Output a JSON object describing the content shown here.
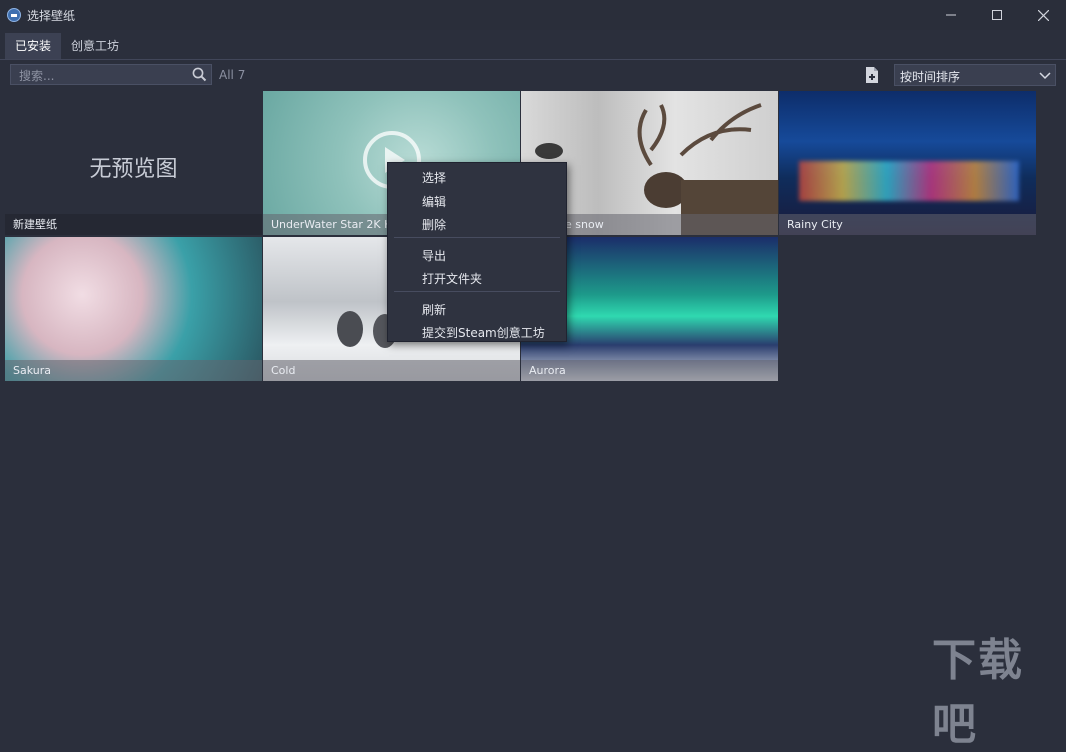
{
  "window": {
    "title": "选择壁纸"
  },
  "tabs": [
    {
      "label": "已安装",
      "active": true
    },
    {
      "label": "创意工坊",
      "active": false
    }
  ],
  "toolbar": {
    "search_placeholder": "搜索...",
    "count": "All 7",
    "sort_selected": "按时间排序"
  },
  "wallpapers": [
    {
      "name": "新建壁纸",
      "preview": "无预览图"
    },
    {
      "name": "UnderWater Star 2K HD"
    },
    {
      "name": "e snow"
    },
    {
      "name": "Rainy City"
    },
    {
      "name": "Sakura"
    },
    {
      "name": "Cold"
    },
    {
      "name": "Aurora"
    }
  ],
  "context_menu": {
    "items": [
      "选择",
      "编辑",
      "删除",
      "导出",
      "打开文件夹",
      "刷新",
      "提交到Steam创意工坊"
    ]
  },
  "watermark": {
    "logo_text": "下载吧"
  },
  "colors": {
    "background": "#2b2f3c",
    "accent": "#4a8ad8"
  }
}
